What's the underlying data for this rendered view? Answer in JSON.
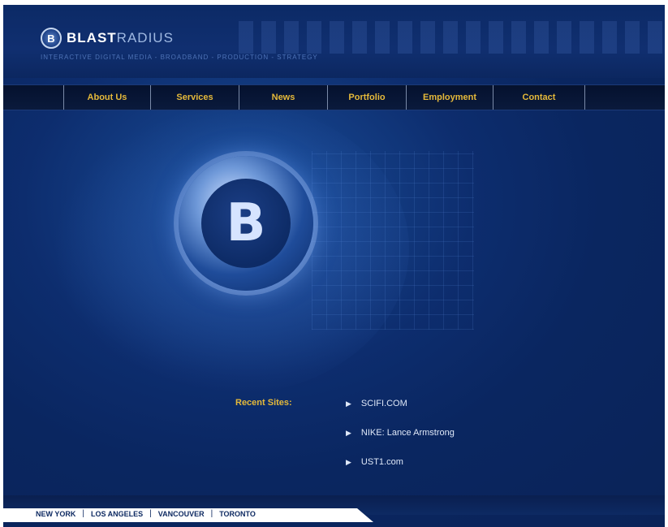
{
  "header": {
    "logo_bold": "BLAST",
    "logo_light": "RADIUS",
    "logo_mark": "B",
    "tagline": "INTERACTIVE DIGITAL MEDIA - BROADBAND - PRODUCTION - STRATEGY"
  },
  "nav": {
    "items": [
      {
        "label": "About Us"
      },
      {
        "label": "Services"
      },
      {
        "label": "News"
      },
      {
        "label": "Portfolio"
      },
      {
        "label": "Employment"
      },
      {
        "label": "Contact"
      }
    ]
  },
  "hero": {
    "emblem_glyph": "B",
    "emblem_icon": "blastradius-emblem-icon"
  },
  "recent": {
    "label": "Recent Sites:",
    "bullet": "▶",
    "sites": [
      {
        "label": "SCIFI.COM"
      },
      {
        "label": "NIKE: Lance Armstrong"
      },
      {
        "label": "UST1.com"
      }
    ]
  },
  "footer": {
    "separator": "|",
    "cities": [
      {
        "label": "NEW YORK"
      },
      {
        "label": "LOS ANGELES"
      },
      {
        "label": "VANCOUVER"
      },
      {
        "label": "TORONTO"
      }
    ]
  },
  "colors": {
    "background": "#0d2d6e",
    "nav_text": "#e5b93a",
    "link_text": "#dfe8f8"
  }
}
